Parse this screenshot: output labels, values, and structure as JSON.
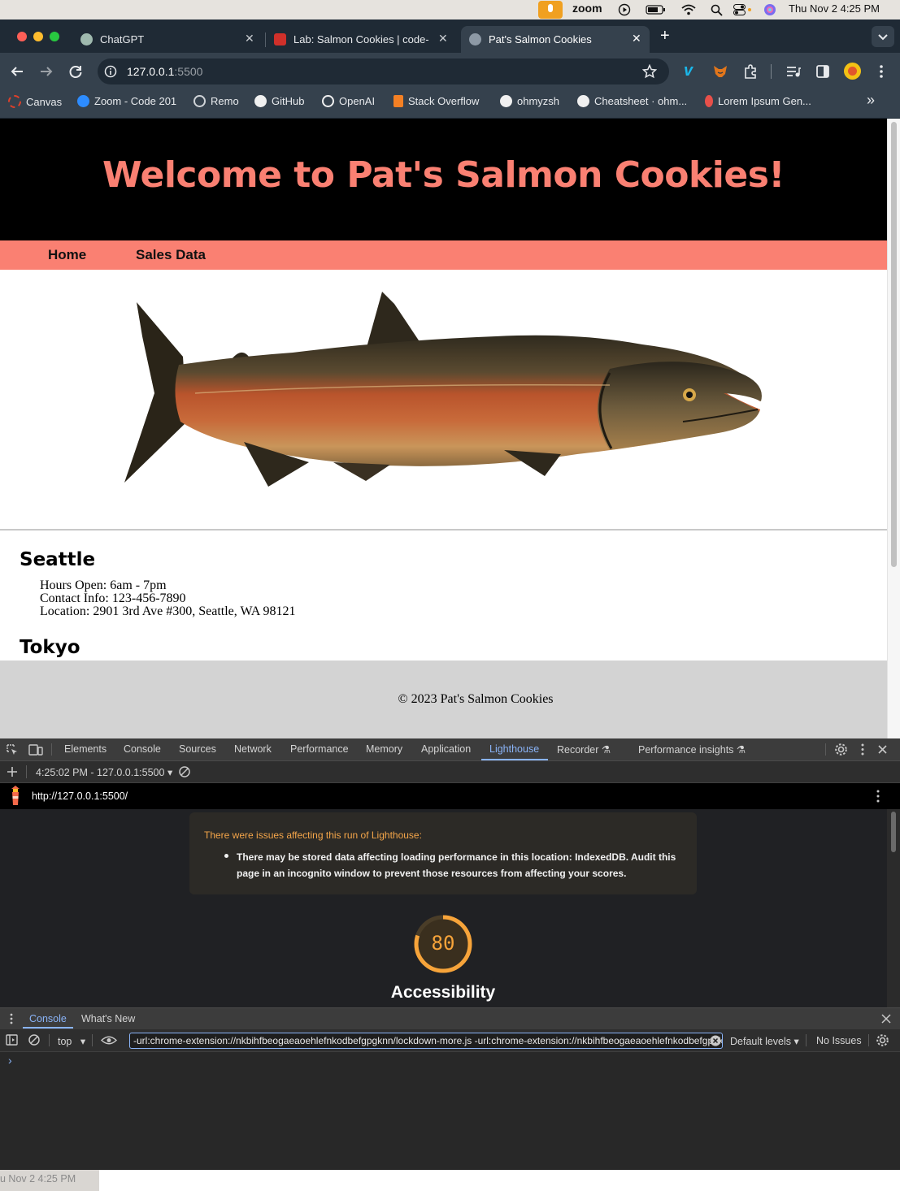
{
  "menubar": {
    "zoom": "zoom",
    "datetime": "Thu Nov 2  4:25 PM"
  },
  "browser": {
    "tabs": [
      {
        "label": "ChatGPT",
        "close": "✕"
      },
      {
        "label": "Lab: Salmon Cookies | code-",
        "close": "✕"
      },
      {
        "label": "Pat's Salmon Cookies",
        "close": "✕"
      }
    ],
    "new_tab": "+",
    "url_host": "127.0.0.1",
    "url_port": ":5500",
    "bookmarks": [
      "Canvas",
      "Zoom - Code 201",
      "Remo",
      "GitHub",
      "OpenAI",
      "Stack Overflow",
      "ohmyzsh",
      "Cheatsheet · ohm...",
      "Lorem Ipsum Gen..."
    ],
    "bookmarks_more": "»"
  },
  "page": {
    "title": "Welcome to Pat's Salmon Cookies!",
    "nav": [
      "Home",
      "Sales Data"
    ],
    "locations": [
      {
        "name": "Seattle",
        "hours": "Hours Open: 6am - 7pm",
        "contact": "Contact Info: 123-456-7890",
        "address": "Location: 2901 3rd Ave #300, Seattle, WA 98121"
      },
      {
        "name": "Tokyo"
      }
    ],
    "footer": "© 2023 Pat's Salmon Cookies",
    "colors": {
      "salmon": "#fa8072",
      "header_bg": "#000000",
      "footer_bg": "#d3d3d3"
    }
  },
  "devtools": {
    "tabs": [
      "Elements",
      "Console",
      "Sources",
      "Network",
      "Performance",
      "Memory",
      "Application",
      "Lighthouse",
      "Recorder",
      "Performance insights"
    ],
    "active_tab": "Lighthouse",
    "report_select": "4:25:02 PM - 127.0.0.1:5500",
    "report_url": "http://127.0.0.1:5500/",
    "warning_title": "There were issues affecting this run of Lighthouse:",
    "warning_item": "There may be stored data affecting loading performance in this location: IndexedDB. Audit this page in an incognito window to prevent those resources from affecting your scores.",
    "score": "80",
    "score_fraction": 0.8,
    "score_label": "Accessibility",
    "drawer_tabs": [
      "Console",
      "What's New"
    ],
    "context": "top",
    "filter_value": "-url:chrome-extension://nkbihfbeogaeaoehlefnkodbefgpgknn/lockdown-more.js -url:chrome-extension://nkbihfbeogaeaoehlefnkodbefgpgknn",
    "levels": "Default levels",
    "issues": "No Issues",
    "prompt": "›"
  },
  "dock": {
    "clock": "u Nov 2  4:25 PM"
  }
}
